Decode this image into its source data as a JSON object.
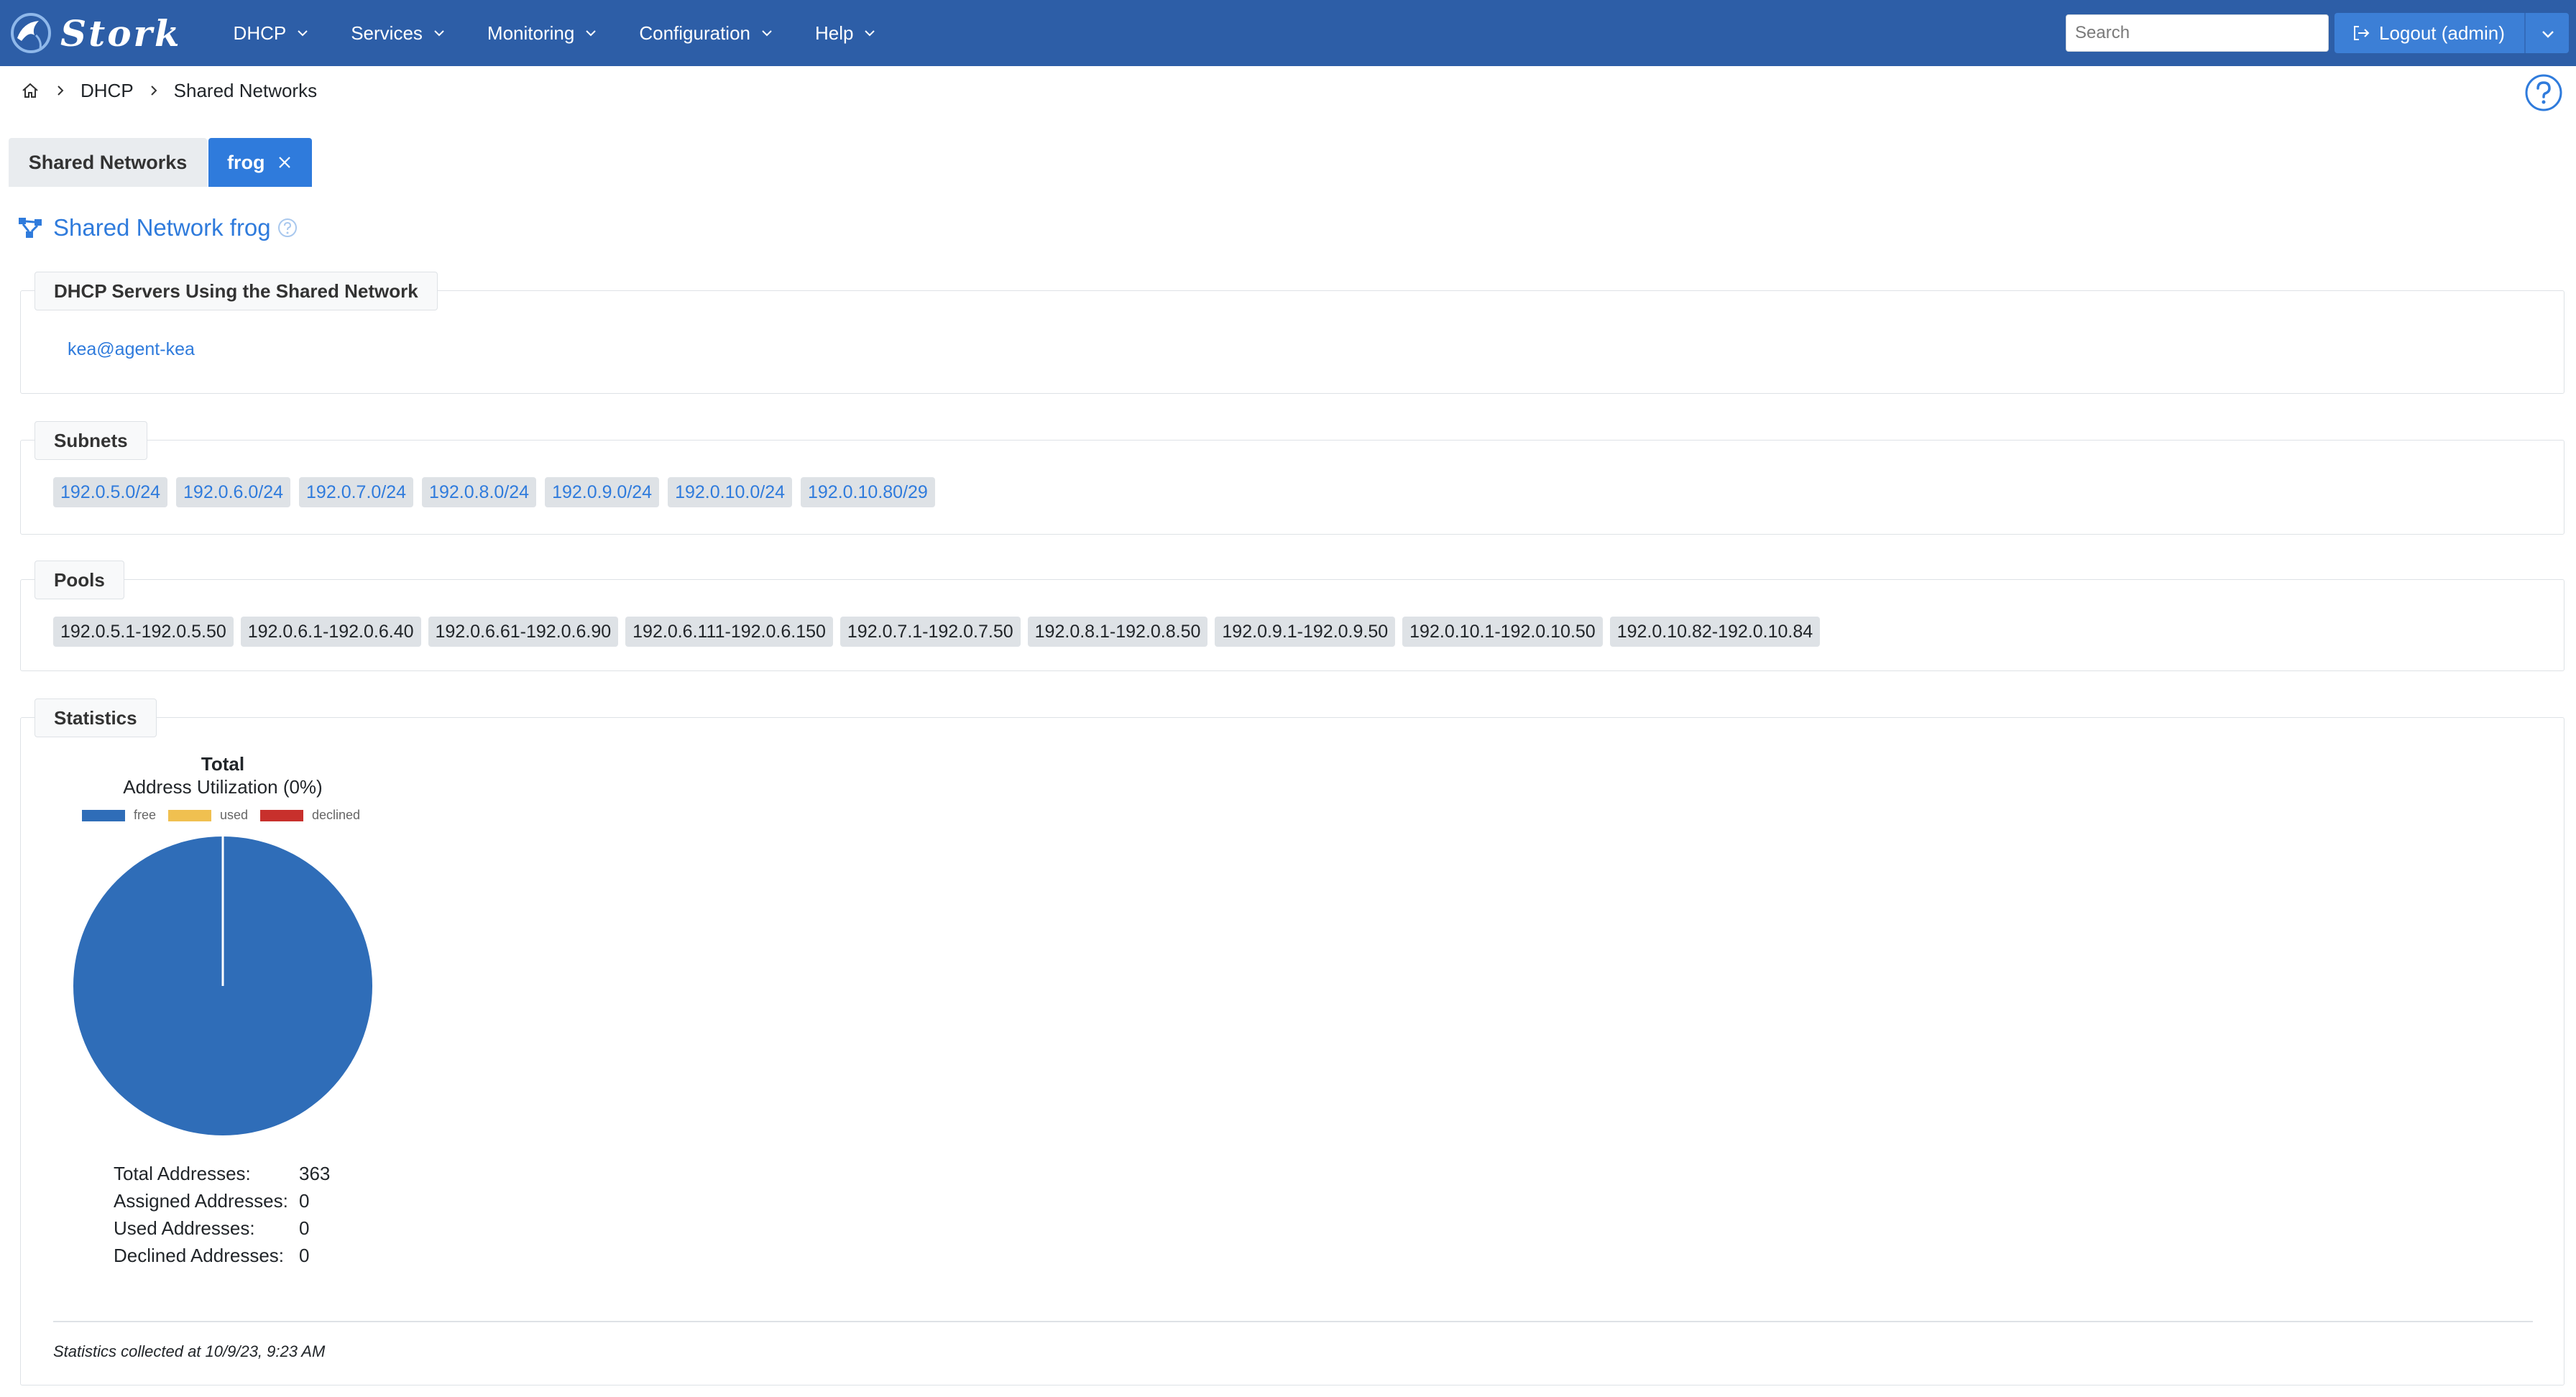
{
  "app": {
    "logo_text": "Stork"
  },
  "nav": {
    "items": [
      {
        "label": "DHCP"
      },
      {
        "label": "Services"
      },
      {
        "label": "Monitoring"
      },
      {
        "label": "Configuration"
      },
      {
        "label": "Help"
      }
    ],
    "search_placeholder": "Search",
    "logout_label": "Logout (admin)"
  },
  "breadcrumb": {
    "items": [
      "DHCP",
      "Shared Networks"
    ]
  },
  "tabs": {
    "list_label": "Shared Networks",
    "active_label": "frog"
  },
  "page": {
    "title": "Shared Network frog"
  },
  "servers": {
    "legend": "DHCP Servers Using the Shared Network",
    "items": [
      "kea@agent-kea"
    ]
  },
  "subnets": {
    "legend": "Subnets",
    "items": [
      "192.0.5.0/24",
      "192.0.6.0/24",
      "192.0.7.0/24",
      "192.0.8.0/24",
      "192.0.9.0/24",
      "192.0.10.0/24",
      "192.0.10.80/29"
    ]
  },
  "pools": {
    "legend": "Pools",
    "items": [
      "192.0.5.1-192.0.5.50",
      "192.0.6.1-192.0.6.40",
      "192.0.6.61-192.0.6.90",
      "192.0.6.111-192.0.6.150",
      "192.0.7.1-192.0.7.50",
      "192.0.8.1-192.0.8.50",
      "192.0.9.1-192.0.9.50",
      "192.0.10.1-192.0.10.50",
      "192.0.10.82-192.0.10.84"
    ]
  },
  "statistics": {
    "legend": "Statistics",
    "rows": [
      {
        "label": "Total Addresses:",
        "value": "363"
      },
      {
        "label": "Assigned Addresses:",
        "value": "0"
      },
      {
        "label": "Used Addresses:",
        "value": "0"
      },
      {
        "label": "Declined Addresses:",
        "value": "0"
      }
    ],
    "collected": "Statistics collected at 10/9/23, 9:23 AM"
  },
  "colors": {
    "navbar": "#2d5ea7",
    "accent": "#2f7bdc",
    "free": "#2f6db8",
    "used": "#f0c050",
    "declined": "#c8302c"
  },
  "chart_data": {
    "type": "pie",
    "title": "Total",
    "subtitle": "Address Utilization (0%)",
    "legend": [
      "free",
      "used",
      "declined"
    ],
    "categories": [
      "free",
      "used",
      "declined"
    ],
    "values": [
      363,
      0,
      0
    ]
  }
}
